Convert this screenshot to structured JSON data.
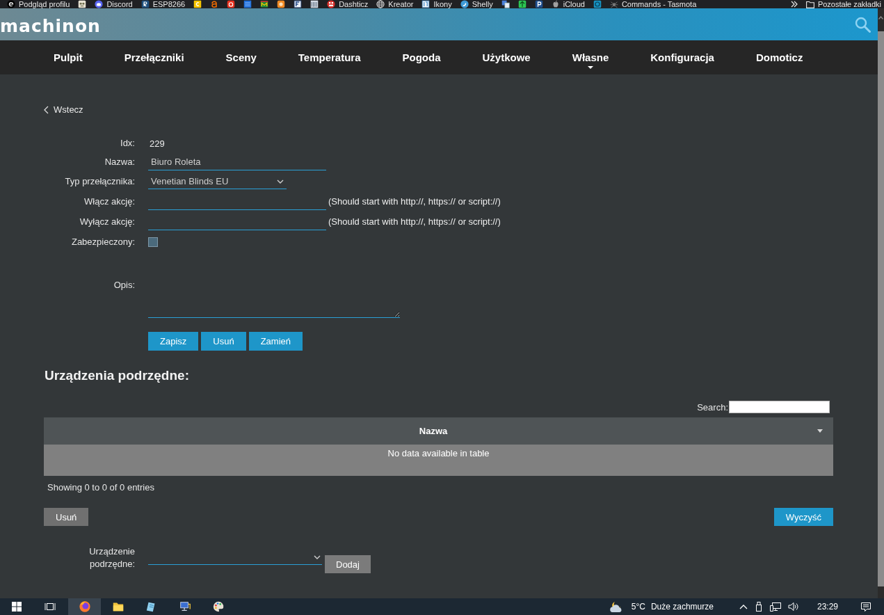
{
  "bookmarks_bar": {
    "items": [
      {
        "kind": "link",
        "label": "Podgląd profilu"
      },
      {
        "kind": "icon"
      },
      {
        "kind": "link",
        "label": "Discord"
      },
      {
        "kind": "link",
        "label": "ESP8266"
      },
      {
        "kind": "icon"
      },
      {
        "kind": "icon"
      },
      {
        "kind": "icon"
      },
      {
        "kind": "icon"
      },
      {
        "kind": "icon"
      },
      {
        "kind": "icon"
      },
      {
        "kind": "icon"
      },
      {
        "kind": "icon"
      },
      {
        "kind": "link",
        "label": "Dashticz"
      },
      {
        "kind": "link",
        "label": "Kreator"
      },
      {
        "kind": "link",
        "label": "Ikony"
      },
      {
        "kind": "link",
        "label": "Shelly"
      },
      {
        "kind": "icon"
      },
      {
        "kind": "icon"
      },
      {
        "kind": "icon"
      },
      {
        "kind": "link",
        "label": "iCloud"
      },
      {
        "kind": "icon"
      },
      {
        "kind": "link",
        "label": "Commands - Tasmota"
      }
    ],
    "other_bookmarks": "Pozostałe zakładki"
  },
  "header": {
    "logo": "machinon"
  },
  "nav": {
    "items": [
      {
        "label": "Pulpit",
        "dropdown": false
      },
      {
        "label": "Przełączniki",
        "dropdown": false
      },
      {
        "label": "Sceny",
        "dropdown": false
      },
      {
        "label": "Temperatura",
        "dropdown": false
      },
      {
        "label": "Pogoda",
        "dropdown": false
      },
      {
        "label": "Użytkowe",
        "dropdown": false
      },
      {
        "label": "Własne",
        "dropdown": true
      },
      {
        "label": "Konfiguracja",
        "dropdown": false
      },
      {
        "label": "Domoticz",
        "dropdown": false
      }
    ]
  },
  "back_link": "Wstecz",
  "device_form": {
    "fields": [
      {
        "kind": "text",
        "label": "Idx:",
        "value": "229"
      },
      {
        "kind": "input",
        "label": "Nazwa:",
        "value": "Biuro Roleta"
      },
      {
        "kind": "select",
        "label": "Typ przełącznika:",
        "value": "Venetian Blinds EU"
      },
      {
        "kind": "input",
        "label": "Włącz akcję:",
        "hint": "(Should start with http://, https:// or script://)"
      },
      {
        "kind": "input",
        "label": "Wyłącz akcję:",
        "hint": "(Should start with http://, https:// or script://)"
      },
      {
        "kind": "checkbox",
        "label": "Zabezpieczony:",
        "checked": false
      },
      {
        "kind": "textarea",
        "label": "Opis:"
      }
    ],
    "buttons": [
      "Zapisz",
      "Usuń",
      "Zamień"
    ]
  },
  "subdevices": {
    "title": "Urządzenia podrzędne:",
    "search_label": "Search:",
    "table": {
      "columns": [
        {
          "label": "Nazwa",
          "sortable": true
        }
      ],
      "empty_message": "No data available in table"
    },
    "info": "Showing 0 to 0 of 0 entries",
    "buttons": [
      {
        "label": "Usuń",
        "kind": "secondary"
      },
      {
        "label": "Wyczyść",
        "kind": "primary"
      }
    ],
    "add": {
      "label": "Urządzenie podrzędne:",
      "button": "Dodaj"
    }
  },
  "taskbar": {
    "apps": [
      {
        "selected": true
      },
      {
        "selected": false
      },
      {
        "selected": false
      },
      {
        "selected": false
      },
      {
        "selected": false
      }
    ],
    "temperature": "5°C",
    "weather": "Duże zachmurze",
    "time": "23:29"
  }
}
